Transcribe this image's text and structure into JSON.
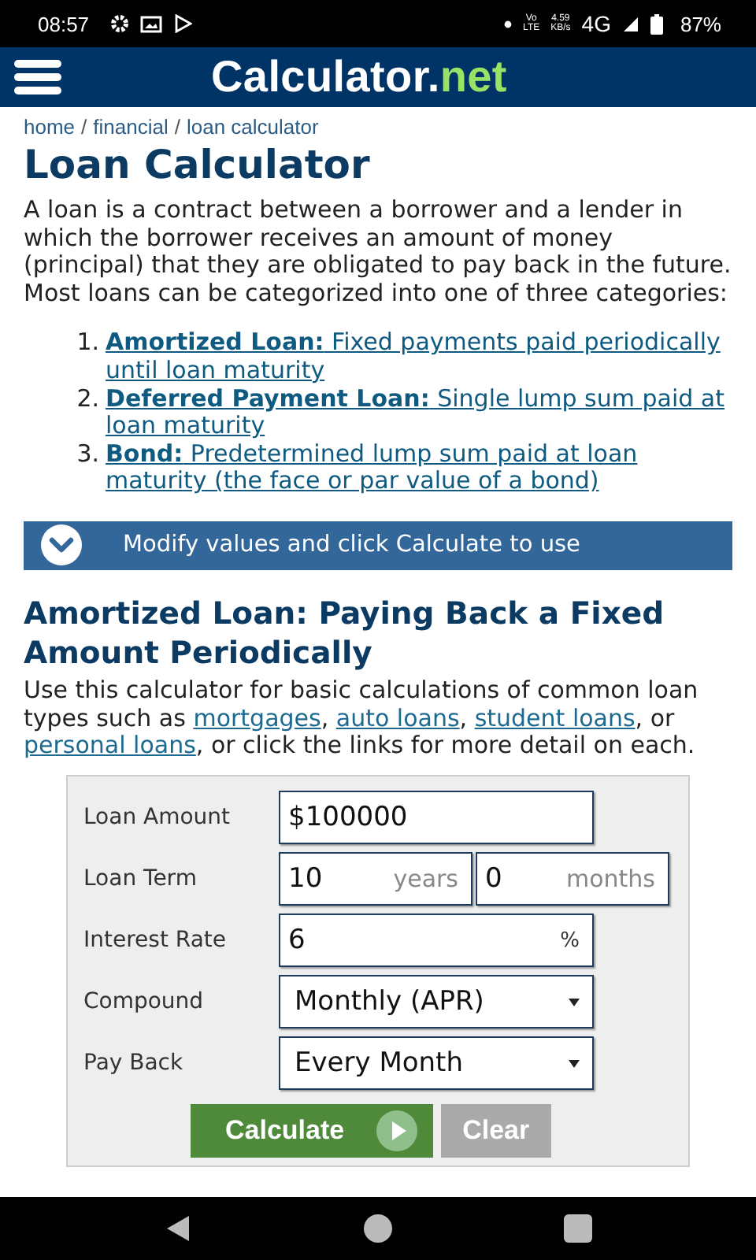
{
  "status_bar": {
    "time": "08:57",
    "volte": [
      "Vo",
      "LTE"
    ],
    "speed": [
      "4.59",
      "KB/s"
    ],
    "network": "4G",
    "battery": "87%"
  },
  "header": {
    "logo_main": "Calculator.",
    "logo_accent": "net"
  },
  "breadcrumb": {
    "separator": "/",
    "items": [
      "home",
      "financial",
      "loan calculator"
    ]
  },
  "title": "Loan Calculator",
  "intro": "A loan is a contract between a borrower and a lender in which the borrower receives an amount of money (principal) that they are obligated to pay back in the future. Most loans can be categorized into one of three categories:",
  "categories": [
    {
      "number": "1.",
      "text": "**Amortized Loan:** Fixed payments paid periodically until loan maturity"
    },
    {
      "number": "2.",
      "text": "**Deferred Payment Loan:** Single lump sum paid at loan maturity"
    },
    {
      "number": "3.",
      "text": "**Bond:** Predetermined lump sum paid at loan maturity (the face or par value of a bond)"
    }
  ],
  "banner": {
    "text": "Modify values and click Calculate to use"
  },
  "section_title": "Amortized Loan: Paying Back a Fixed Amount Periodically",
  "description": [
    {
      "kind": "text",
      "text": "Use this calculator for basic calculations of common loan types such as "
    },
    {
      "kind": "link",
      "text": "mortgages"
    },
    {
      "kind": "text",
      "text": ", "
    },
    {
      "kind": "link",
      "text": "auto loans"
    },
    {
      "kind": "text",
      "text": ", "
    },
    {
      "kind": "link",
      "text": "student loans"
    },
    {
      "kind": "text",
      "text": ", or "
    },
    {
      "kind": "link",
      "text": "personal loans"
    },
    {
      "kind": "text",
      "text": ", or click the links for more detail on each."
    }
  ],
  "form": [
    {
      "kind": "input",
      "label": "Loan Amount",
      "value": "$100000"
    },
    {
      "kind": "term",
      "label": "Loan Term",
      "fields": [
        {
          "value": "10",
          "unit": "years"
        },
        {
          "value": "0",
          "unit": "months"
        }
      ]
    },
    {
      "kind": "input",
      "label": "Interest Rate",
      "value": "6",
      "unit": "%"
    },
    {
      "kind": "select",
      "label": "Compound",
      "value": "Monthly (APR)"
    },
    {
      "kind": "select",
      "label": "Pay Back",
      "value": "Every Month"
    }
  ],
  "buttons": [
    {
      "kind": "primary",
      "label": "Calculate"
    },
    {
      "kind": "secondary",
      "label": "Clear"
    }
  ]
}
